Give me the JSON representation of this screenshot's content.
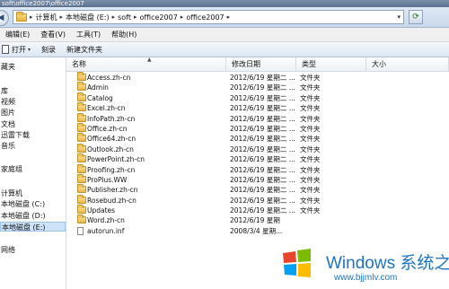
{
  "window": {
    "title": "soft\\office2007\\office2007"
  },
  "address": {
    "crumbs": [
      "计算机",
      "本地磁盘 (E:)",
      "soft",
      "office2007",
      "office2007"
    ]
  },
  "menu": [
    "编辑(E)",
    "查看(V)",
    "工具(T)",
    "帮助(H)"
  ],
  "toolbar": {
    "open": "打开",
    "burn": "刻录",
    "new_folder": "新建文件夹"
  },
  "nav": {
    "items": [
      "藏夹",
      "",
      "库",
      "视频",
      "图片",
      "文档",
      "迅雷下载",
      "音乐",
      "",
      "家庭组",
      "",
      "计算机",
      "本地磁盘 (C:)",
      "本地磁盘 (D:)",
      "本地磁盘 (E:)",
      "",
      "网络"
    ],
    "selected_index": 14
  },
  "columns": {
    "name": "名称",
    "date": "修改日期",
    "type": "类型",
    "size": "大小"
  },
  "files": [
    {
      "name": "Access.zh-cn",
      "date": "2012/6/19 星期二 ...",
      "type": "文件夹",
      "icon": "folder-icon"
    },
    {
      "name": "Admin",
      "date": "2012/6/19 星期二 ...",
      "type": "文件夹",
      "icon": "folder-icon"
    },
    {
      "name": "Catalog",
      "date": "2012/6/19 星期二 ...",
      "type": "文件夹",
      "icon": "folder-icon"
    },
    {
      "name": "Excel.zh-cn",
      "date": "2012/6/19 星期二 ...",
      "type": "文件夹",
      "icon": "folder-icon"
    },
    {
      "name": "InfoPath.zh-cn",
      "date": "2012/6/19 星期二 ...",
      "type": "文件夹",
      "icon": "folder-icon"
    },
    {
      "name": "Office.zh-cn",
      "date": "2012/6/19 星期二 ...",
      "type": "文件夹",
      "icon": "folder-icon"
    },
    {
      "name": "Office64.zh-cn",
      "date": "2012/6/19 星期二 ...",
      "type": "文件夹",
      "icon": "folder-icon"
    },
    {
      "name": "Outlook.zh-cn",
      "date": "2012/6/19 星期二 ...",
      "type": "文件夹",
      "icon": "folder-icon"
    },
    {
      "name": "PowerPoint.zh-cn",
      "date": "2012/6/19 星期二 ...",
      "type": "文件夹",
      "icon": "folder-icon"
    },
    {
      "name": "Proofing.zh-cn",
      "date": "2012/6/19 星期二 ...",
      "type": "文件夹",
      "icon": "folder-icon"
    },
    {
      "name": "ProPlus.WW",
      "date": "2012/6/19 星期二 ...",
      "type": "文件夹",
      "icon": "folder-icon"
    },
    {
      "name": "Publisher.zh-cn",
      "date": "2012/6/19 星期二 ...",
      "type": "文件夹",
      "icon": "folder-icon"
    },
    {
      "name": "Rosebud.zh-cn",
      "date": "2012/6/19 星期二 ...",
      "type": "文件夹",
      "icon": "folder-icon"
    },
    {
      "name": "Updates",
      "date": "2012/6/19 星期二 ...",
      "type": "文件夹",
      "icon": "folder-icon"
    },
    {
      "name": "Word.zh-cn",
      "date": "2012/6/19 星期",
      "type": "",
      "icon": "folder-icon"
    },
    {
      "name": "autorun.inf",
      "date": "2008/3/4 星期...",
      "type": "",
      "icon": "file-icon"
    }
  ],
  "watermark": {
    "brand": "Windows 系统之家",
    "url": "www.bjjmlv.com"
  },
  "colors": {
    "addressbar": "#dfe9f5",
    "selected": "#cfe3f8",
    "watermark": "#1c75c6"
  }
}
